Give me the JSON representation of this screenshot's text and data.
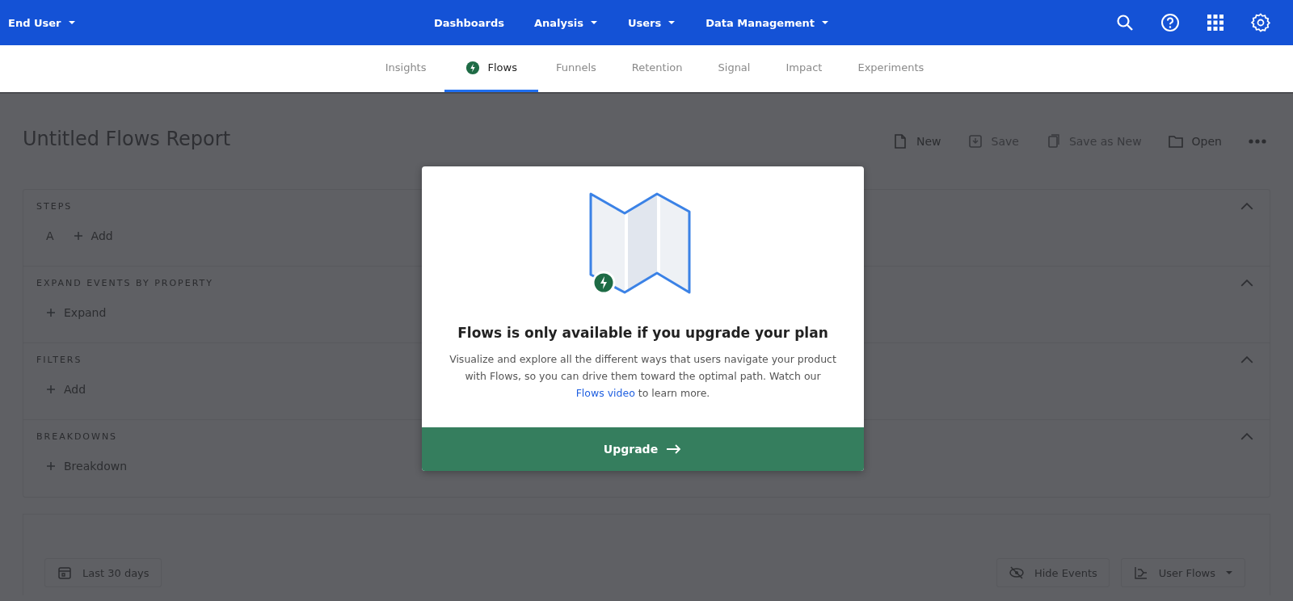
{
  "top_nav": {
    "account": "End User",
    "menu": [
      {
        "label": "Dashboards",
        "has_dropdown": false
      },
      {
        "label": "Analysis",
        "has_dropdown": true
      },
      {
        "label": "Users",
        "has_dropdown": true
      },
      {
        "label": "Data Management",
        "has_dropdown": true
      }
    ]
  },
  "tabs": [
    {
      "label": "Insights",
      "selected": false
    },
    {
      "label": "Flows",
      "selected": true
    },
    {
      "label": "Funnels",
      "selected": false
    },
    {
      "label": "Retention",
      "selected": false
    },
    {
      "label": "Signal",
      "selected": false
    },
    {
      "label": "Impact",
      "selected": false
    },
    {
      "label": "Experiments",
      "selected": false
    }
  ],
  "report": {
    "title": "Untitled Flows Report",
    "actions": [
      {
        "label": "New",
        "disabled": false
      },
      {
        "label": "Save",
        "disabled": true
      },
      {
        "label": "Save as New",
        "disabled": true
      },
      {
        "label": "Open",
        "disabled": false
      }
    ]
  },
  "sections": [
    {
      "heading": "STEPS",
      "expanded": true,
      "controls": [
        {
          "kind": "step",
          "label": "A"
        },
        {
          "kind": "add",
          "label": "Add"
        }
      ]
    },
    {
      "heading": "EXPAND EVENTS BY PROPERTY",
      "expanded": true,
      "controls": [
        {
          "kind": "add",
          "label": "Expand"
        }
      ]
    },
    {
      "heading": "FILTERS",
      "expanded": true,
      "controls": [
        {
          "kind": "add",
          "label": "Add"
        }
      ]
    },
    {
      "heading": "BREAKDOWNS",
      "expanded": true,
      "controls": [
        {
          "kind": "add",
          "label": "Breakdown"
        }
      ]
    }
  ],
  "footer": {
    "date_range": "Last 30 days",
    "hide_events": "Hide Events",
    "view": "User Flows"
  },
  "modal": {
    "title": "Flows is only available if you upgrade your plan",
    "text_before": "Visualize and explore all the different ways that users navigate your product with Flows, so you can drive them toward the optimal path. Watch our",
    "link": "Flows video",
    "text_after": "to learn more.",
    "button": "Upgrade"
  }
}
